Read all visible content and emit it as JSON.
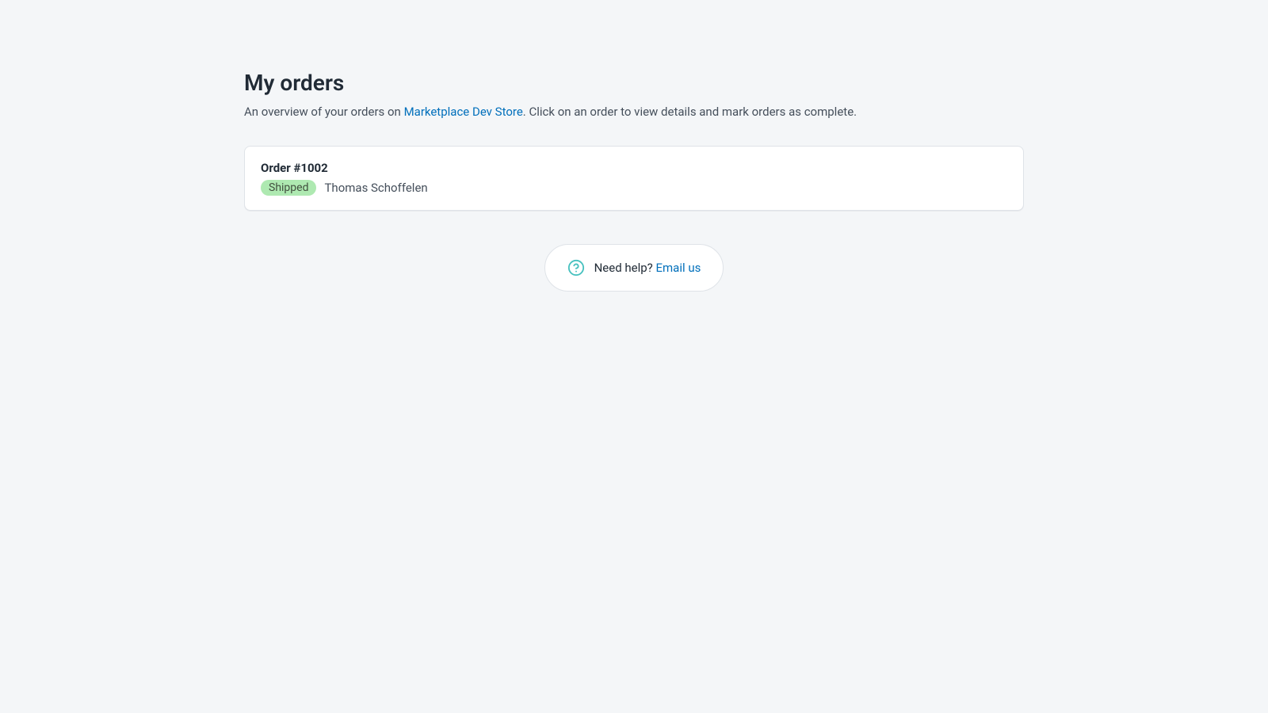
{
  "header": {
    "title": "My orders",
    "subtitle_prefix": "An overview of your orders on ",
    "store_link_text": "Marketplace Dev Store",
    "subtitle_suffix": ". Click on an order to view details and mark orders as complete."
  },
  "orders": [
    {
      "title": "Order #1002",
      "status_label": "Shipped",
      "customer_name": "Thomas Schoffelen"
    }
  ],
  "help": {
    "prompt": "Need help? ",
    "link_text": "Email us"
  }
}
